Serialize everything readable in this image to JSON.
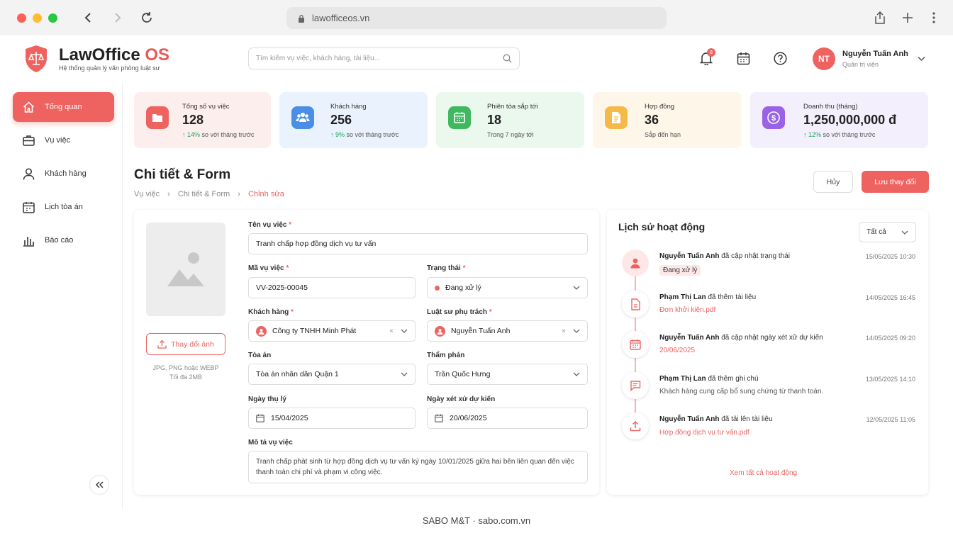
{
  "browser": {
    "url": "lawofficeos.vn"
  },
  "brand": {
    "name_main": "LawOffice",
    "name_accent": "OS",
    "tagline": "Hệ thống quản lý văn phòng luật sư"
  },
  "search": {
    "placeholder": "Tìm kiếm vụ việc, khách hàng, tài liệu..."
  },
  "notifications": {
    "count": "8"
  },
  "user": {
    "initials": "NT",
    "name": "Nguyễn Tuấn Anh",
    "role": "Quản trị viên"
  },
  "sidebar": {
    "items": [
      {
        "label": "Tổng quan",
        "icon": "home-icon"
      },
      {
        "label": "Vụ việc",
        "icon": "briefcase-icon"
      },
      {
        "label": "Khách hàng",
        "icon": "user-icon"
      },
      {
        "label": "Lịch tòa án",
        "icon": "calendar-icon"
      },
      {
        "label": "Báo cáo",
        "icon": "bar-chart-icon"
      }
    ]
  },
  "stats": [
    {
      "label": "Tổng số vụ việc",
      "value": "128",
      "trend": "14%",
      "note": "so với tháng trước",
      "icon": "folder-icon",
      "bg": "#fdeeee",
      "accent": "#ee6360"
    },
    {
      "label": "Khách hàng",
      "value": "256",
      "trend": "9%",
      "note": "so với tháng trước",
      "icon": "users-icon",
      "bg": "#eaf3fd",
      "accent": "#4a8fe7"
    },
    {
      "label": "Phiên tòa sắp tới",
      "value": "18",
      "trend": "",
      "note": "Trong 7 ngày tới",
      "icon": "calendar-icon",
      "bg": "#ebf8ee",
      "accent": "#3fb85f"
    },
    {
      "label": "Hợp đồng",
      "value": "36",
      "trend": "",
      "note": "Sắp đến hạn",
      "icon": "document-icon",
      "bg": "#fef6e9",
      "accent": "#f5b94a"
    },
    {
      "label": "Doanh thu (tháng)",
      "value": "1,250,000,000 đ",
      "trend": "12%",
      "note": "so với tháng trước",
      "icon": "dollar-icon",
      "bg": "#f3effd",
      "accent": "#9a63e6"
    }
  ],
  "page": {
    "title": "Chi tiết & Form",
    "breadcrumb": [
      "Vụ việc",
      "Chi tiết & Form",
      "Chỉnh sửa"
    ],
    "cancel": "Hủy",
    "save": "Lưu thay đổi"
  },
  "image_box": {
    "button": "Thay đổi ảnh",
    "hint1": "JPG, PNG hoặc WEBP",
    "hint2": "Tối đa 2MB"
  },
  "form": {
    "case_name": {
      "label": "Tên vụ việc",
      "value": "Tranh chấp hợp đồng dịch vụ tư vấn"
    },
    "case_code": {
      "label": "Mã vụ việc",
      "value": "VV-2025-00045"
    },
    "status": {
      "label": "Trạng thái",
      "value": "Đang xử lý"
    },
    "client": {
      "label": "Khách hàng",
      "value": "Công ty TNHH Minh Phát"
    },
    "lawyer": {
      "label": "Luật sư phụ trách",
      "value": "Nguyễn Tuấn Anh"
    },
    "court": {
      "label": "Tòa án",
      "value": "Tòa án nhân dân Quận 1"
    },
    "judge": {
      "label": "Thẩm phán",
      "value": "Trần Quốc Hưng"
    },
    "accept_date": {
      "label": "Ngày thụ lý",
      "value": "15/04/2025"
    },
    "trial_date": {
      "label": "Ngày xét xử dự kiến",
      "value": "20/06/2025"
    },
    "description": {
      "label": "Mô tả vụ việc",
      "value": "Tranh chấp phát sinh từ hợp đồng dịch vụ tư vấn ký ngày 10/01/2025 giữa hai bên liên quan đến việc thanh toán chi phí và phạm vi công việc."
    }
  },
  "history": {
    "title": "Lịch sử hoạt động",
    "filter": "Tất cả",
    "more": "Xem tất cả hoạt động",
    "items": [
      {
        "actor": "Nguyễn Tuấn Anh",
        "action": "đã cập nhật trạng thái",
        "time": "15/05/2025 10:30",
        "detail": "Đang xử lý",
        "icon": "user-icon"
      },
      {
        "actor": "Phạm Thị Lan",
        "action": "đã thêm tài liệu",
        "time": "14/05/2025 16:45",
        "detail": "Đơn khởi kiện.pdf",
        "icon": "document-icon"
      },
      {
        "actor": "Nguyễn Tuấn Anh",
        "action": "đã cập nhật ngày xét xử dự kiến",
        "time": "14/05/2025 09:20",
        "detail": "20/06/2025",
        "icon": "calendar-icon"
      },
      {
        "actor": "Phạm Thị Lan",
        "action": "đã thêm ghi chú",
        "time": "13/05/2025 14:10",
        "detail": "Khách hàng cung cấp bổ sung chứng từ thanh toán.",
        "icon": "comment-icon"
      },
      {
        "actor": "Nguyễn Tuấn Anh",
        "action": "đã tải lên tài liệu",
        "time": "12/05/2025 11:05",
        "detail": "Hợp đồng dịch vụ tư vấn.pdf",
        "icon": "upload-icon"
      }
    ]
  },
  "footer": {
    "text": "SABO M&T · sabo.com.vn"
  }
}
